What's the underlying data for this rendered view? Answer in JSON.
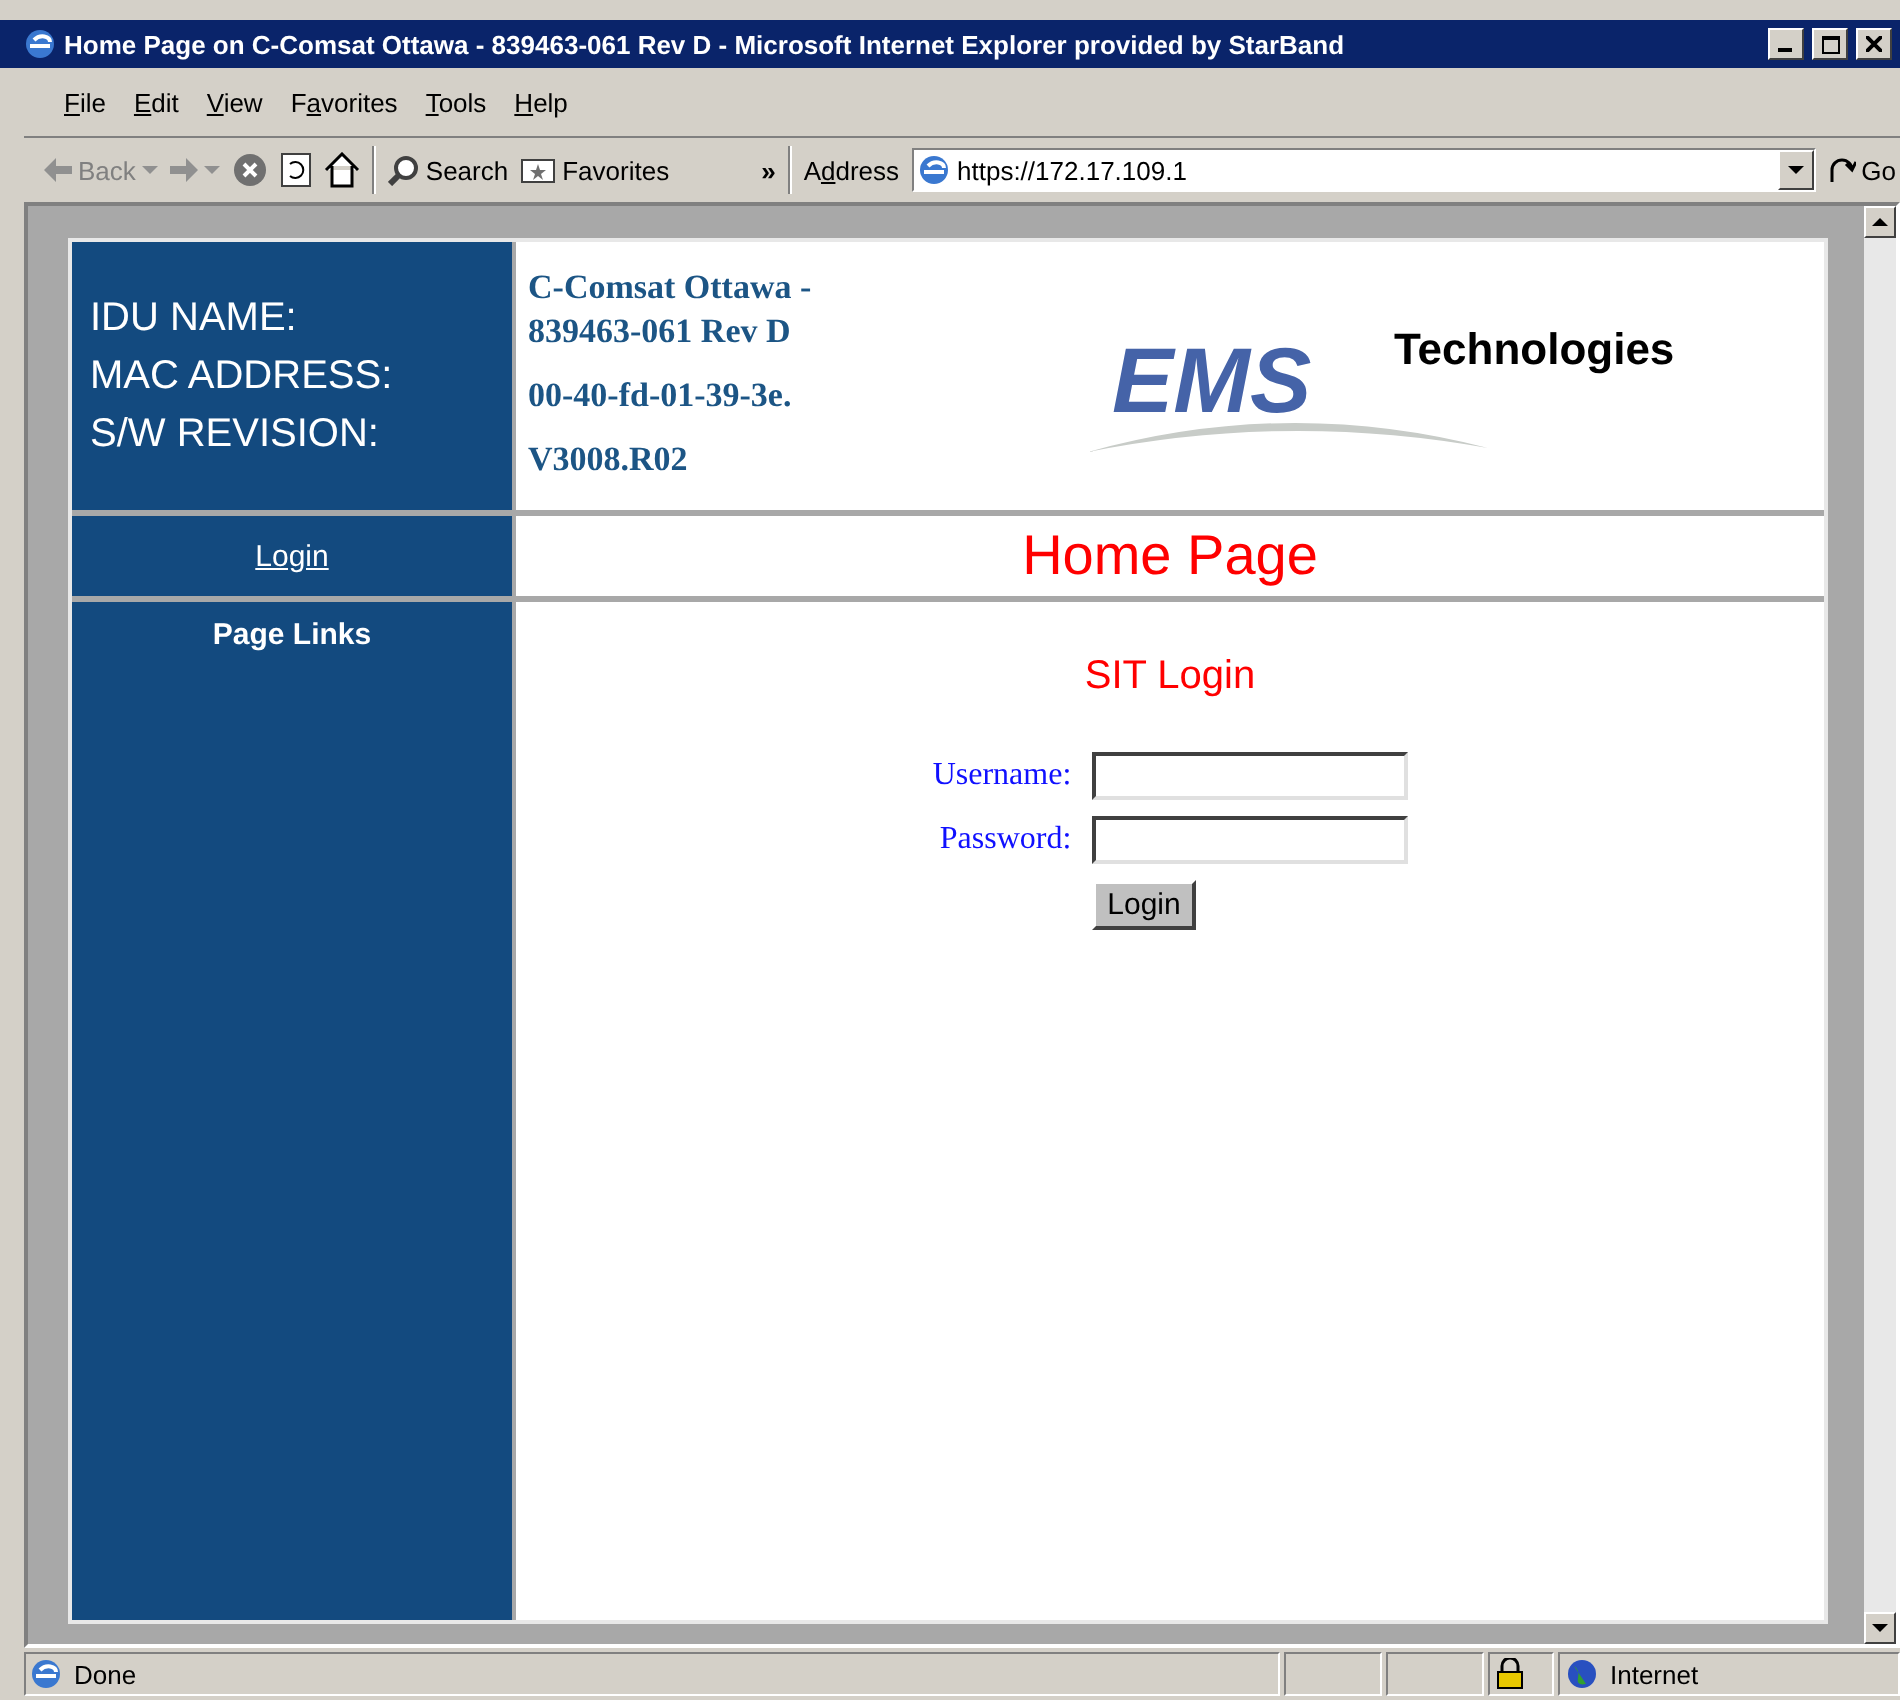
{
  "window": {
    "title": "Home Page on C-Comsat Ottawa - 839463-061 Rev D - Microsoft Internet Explorer provided by StarBand"
  },
  "menu": [
    {
      "key": "F",
      "post": "ile"
    },
    {
      "key": "E",
      "post": "dit"
    },
    {
      "key": "V",
      "post": "iew"
    },
    {
      "pre": "F",
      "key": "a",
      "post": "vorites"
    },
    {
      "key": "T",
      "post": "ools"
    },
    {
      "key": "H",
      "post": "elp"
    }
  ],
  "toolbar": {
    "back": {
      "label": "Back",
      "disabled": true
    },
    "forward": {
      "disabled": true
    },
    "search": "Search",
    "favorites": "Favorites",
    "more": "»",
    "address_label": {
      "pre": "A",
      "key": "d",
      "post": "dress"
    },
    "url": "https://172.17.109.1",
    "go": "Go"
  },
  "page": {
    "info_labels": [
      "IDU NAME:",
      "MAC ADDRESS:",
      "S/W REVISION:"
    ],
    "info_values": [
      "C-Comsat Ottawa - 839463-061 Rev D",
      "00-40-fd-01-39-3e.",
      "V3008.R02"
    ],
    "logo": {
      "mark": "EMS",
      "word": "Technologies"
    },
    "nav_link": "Login",
    "title": "Home Page",
    "sidebar_heading": "Page Links",
    "login": {
      "heading": "SIT Login",
      "fields": [
        {
          "label": "Username:"
        },
        {
          "label": "Password:"
        }
      ],
      "button": "Login"
    }
  },
  "status_bar": {
    "text": "Done",
    "zone": "Internet"
  }
}
